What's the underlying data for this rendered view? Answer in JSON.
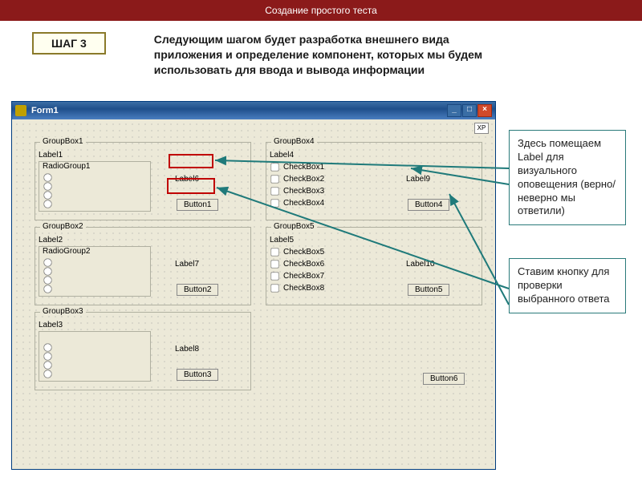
{
  "header": "Создание простого теста",
  "step": {
    "label": "ШАГ 3",
    "text": "Следующим шагом будет разработка внешнего вида приложения и определение компонент, которых мы будем использовать для ввода и вывода информации"
  },
  "window": {
    "title": "Form1",
    "xp_label": "XP",
    "btn_min": "_",
    "btn_max": "□",
    "btn_close": "×"
  },
  "gb1": {
    "title": "GroupBox1",
    "label": "Label1",
    "radio": "RadioGroup1",
    "lbl6": "Label6",
    "btn": "Button1"
  },
  "gb2": {
    "title": "GroupBox2",
    "label": "Label2",
    "radio": "RadioGroup2",
    "lbl7": "Label7",
    "btn": "Button2"
  },
  "gb3": {
    "title": "GroupBox3",
    "label": "Label3",
    "lbl8": "Label8",
    "btn": "Button3"
  },
  "gb4": {
    "title": "GroupBox4",
    "label": "Label4",
    "checks": [
      "CheckBox1",
      "CheckBox2",
      "CheckBox3",
      "CheckBox4"
    ],
    "lbl9": "Label9",
    "btn": "Button4"
  },
  "gb5": {
    "title": "GroupBox5",
    "label": "Label5",
    "checks": [
      "CheckBox5",
      "CheckBox6",
      "CheckBox7",
      "CheckBox8"
    ],
    "lbl10": "Label10",
    "btn": "Button5"
  },
  "footer_btn": "Button6",
  "callout1": "Здесь помещаем Label для визуального оповещения (верно/неверно мы ответили)",
  "callout2": "Ставим кнопку для проверки выбранного ответа"
}
